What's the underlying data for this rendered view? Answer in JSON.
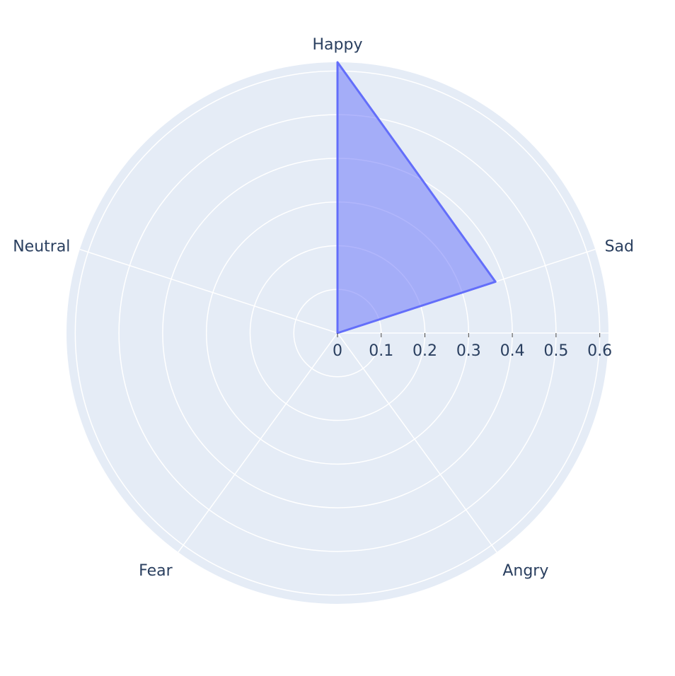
{
  "chart_data": {
    "type": "radar",
    "title": "",
    "categories": [
      "Happy",
      "Sad",
      "Angry",
      "Fear",
      "Neutral"
    ],
    "series": [
      {
        "values": [
          0.62,
          0.38,
          0,
          0,
          0
        ],
        "color": "#636efa"
      }
    ],
    "radial_range": [
      0,
      0.62
    ],
    "radial_ticks": [
      "0",
      "0.1",
      "0.2",
      "0.3",
      "0.4",
      "0.5",
      "0.6"
    ],
    "grid": true,
    "background_color": "#e5ecf6",
    "grid_color": "#ffffff",
    "label_color": "#2a3f5f"
  }
}
